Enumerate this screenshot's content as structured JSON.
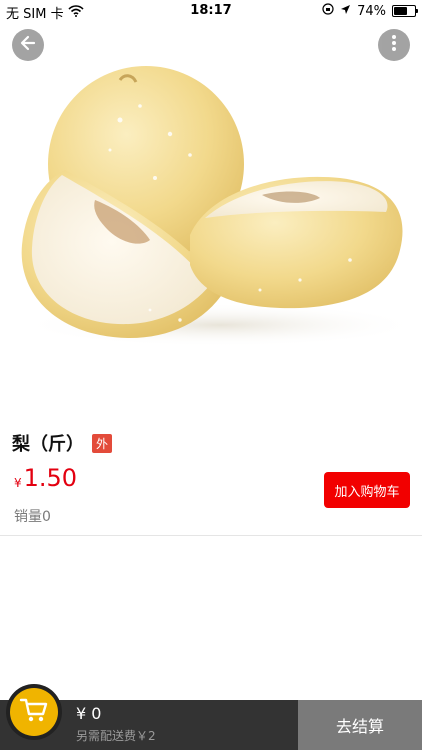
{
  "status_bar": {
    "carrier": "无 SIM 卡",
    "time": "18:17",
    "battery": "74%",
    "battery_level": 0.74
  },
  "product": {
    "name": "梨（斤）",
    "tag": "外",
    "currency": "¥",
    "price": "1.50",
    "sales": "销量0",
    "add_to_cart": "加入购物车"
  },
  "cart_bar": {
    "total": "¥ 0",
    "delivery_fee": "另需配送费￥2",
    "checkout": "去结算"
  },
  "colors": {
    "price_red": "#e30010",
    "add_cart_red": "#f20000",
    "tag_red": "#e34b3a",
    "cart_yellow": "#f0b400",
    "bottom_bar": "#333333",
    "checkout_gray": "#7a7a7a"
  },
  "icons": [
    "wifi-icon",
    "orientation-lock-icon",
    "location-arrow-icon",
    "battery-icon",
    "back-arrow-icon",
    "more-vertical-icon",
    "shopping-cart-icon"
  ]
}
